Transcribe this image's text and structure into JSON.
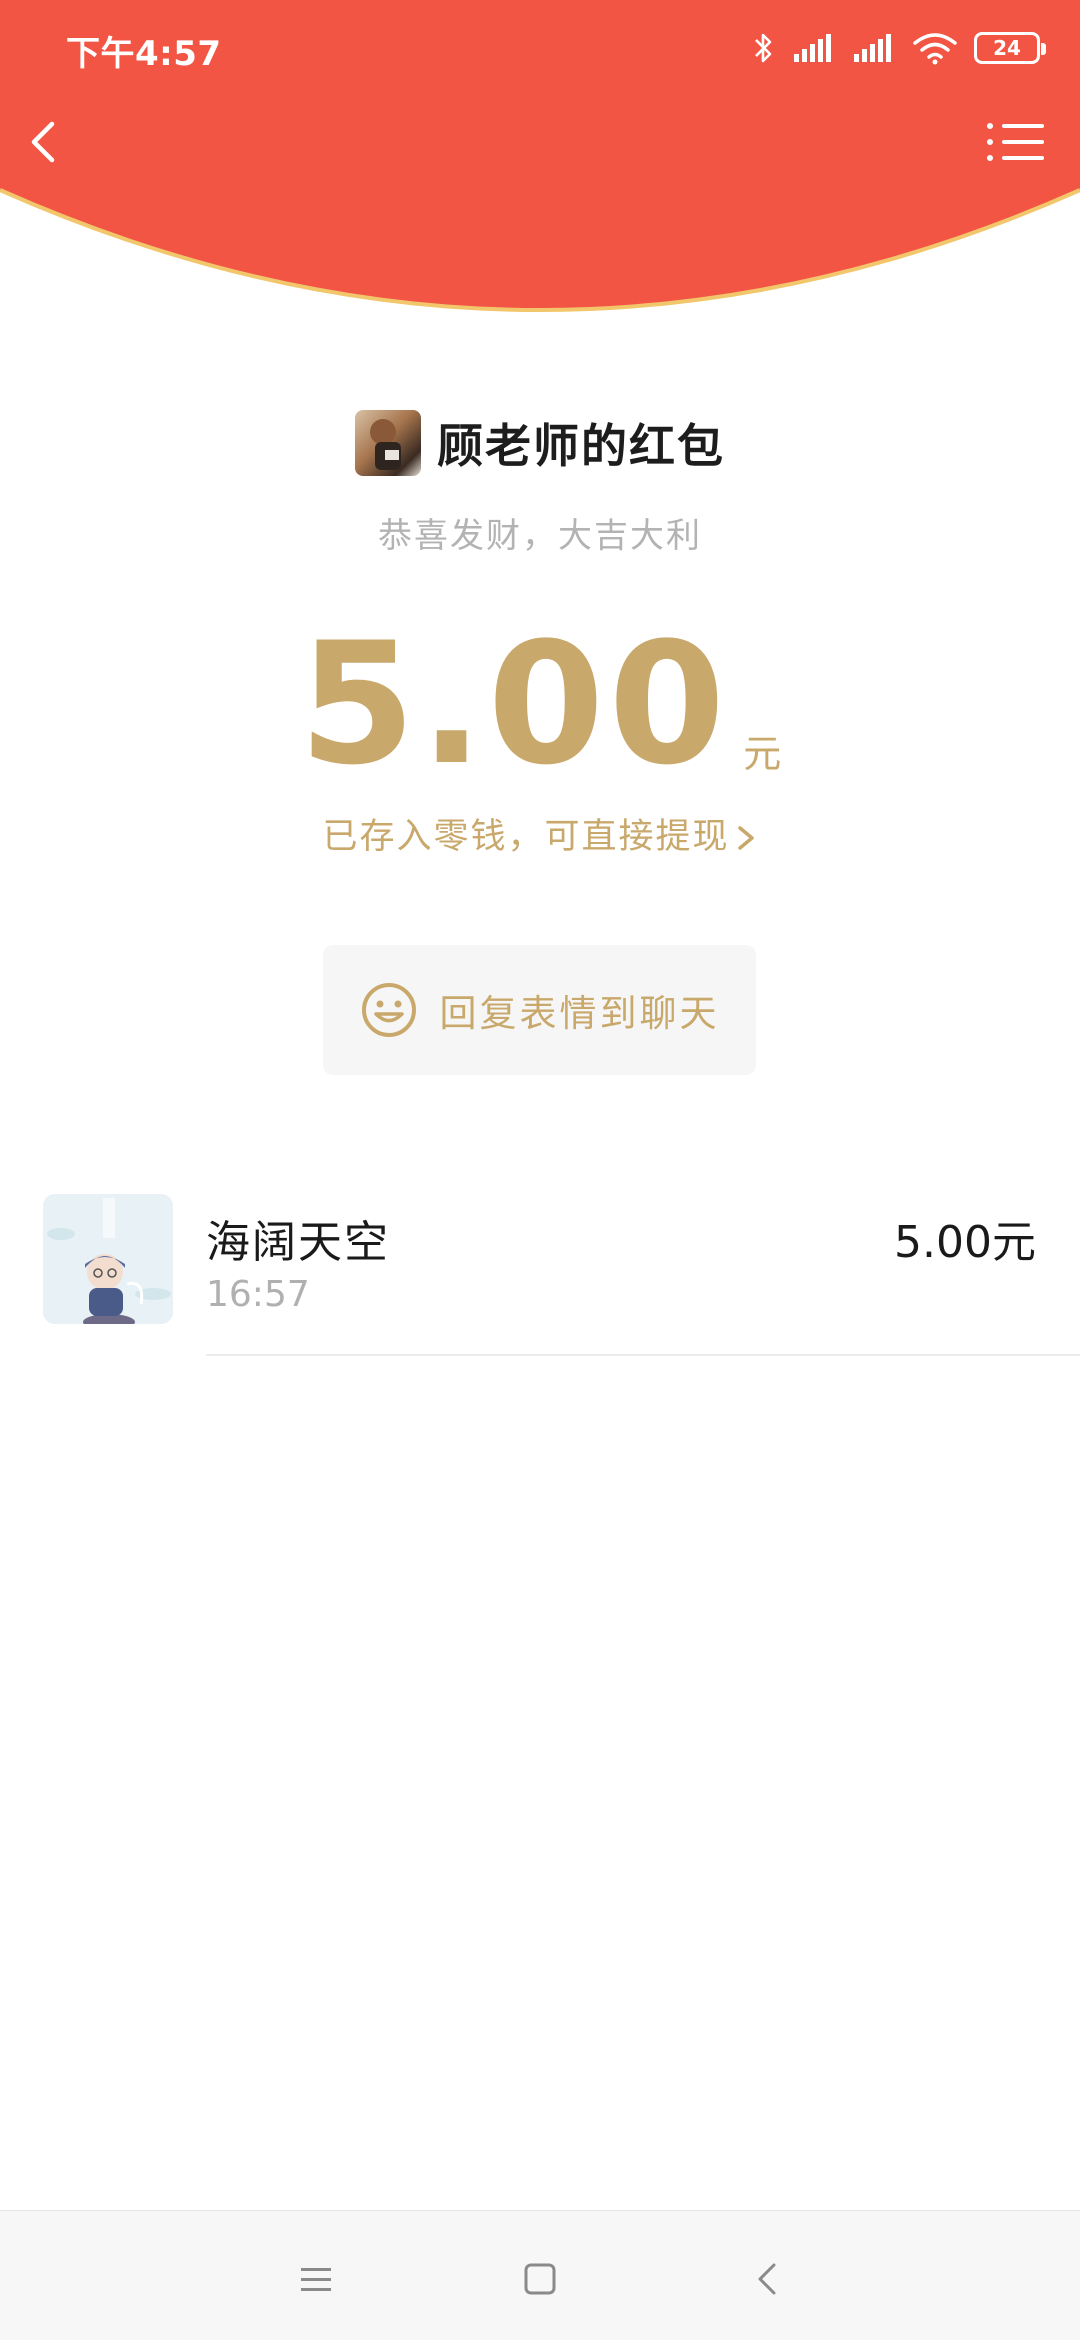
{
  "status_bar": {
    "time": "下午4:57",
    "battery": "24",
    "icons": [
      "bluetooth-icon",
      "signal-icon",
      "signal-icon",
      "wifi-icon",
      "battery-icon"
    ]
  },
  "header": {
    "color": "#f25544",
    "border_color": "#f2c66b",
    "back_icon": "back-arrow-icon",
    "menu_icon": "list-menu-icon"
  },
  "packet": {
    "sender_name": "顾老师的红包",
    "greeting": "恭喜发财，大吉大利",
    "amount": "5.00",
    "unit": "元",
    "deposit_note": "已存入零钱，可直接提现",
    "reply_label": "回复表情到聊天",
    "accent_color": "#c9a86b"
  },
  "receivers": [
    {
      "name": "海阔天空",
      "time": "16:57",
      "amount": "5.00元"
    }
  ],
  "bottom_nav": [
    "menu-icon",
    "home-icon",
    "back-icon"
  ]
}
